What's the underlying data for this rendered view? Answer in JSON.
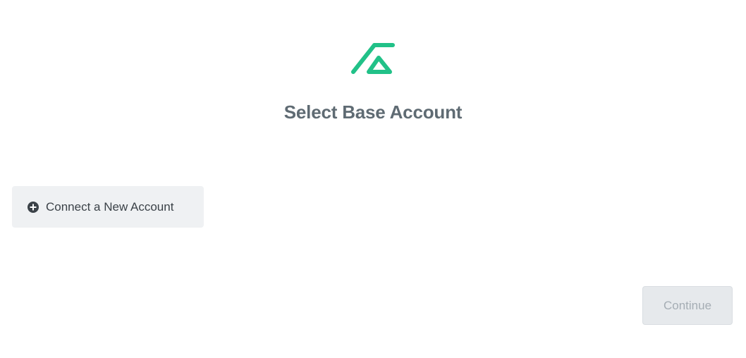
{
  "colors": {
    "brand_accent": "#21c188",
    "title_text": "#5f6b73",
    "button_bg": "#eff1f3",
    "button_text": "#3b4248",
    "disabled_bg": "#e6e9ec",
    "disabled_text": "#a5adb4"
  },
  "header": {
    "logo_icon": "base-logo-icon",
    "title": "Select Base Account"
  },
  "actions": {
    "connect_icon": "plus-circle-icon",
    "connect_label": "Connect a New Account",
    "continue_label": "Continue",
    "continue_enabled": false
  }
}
